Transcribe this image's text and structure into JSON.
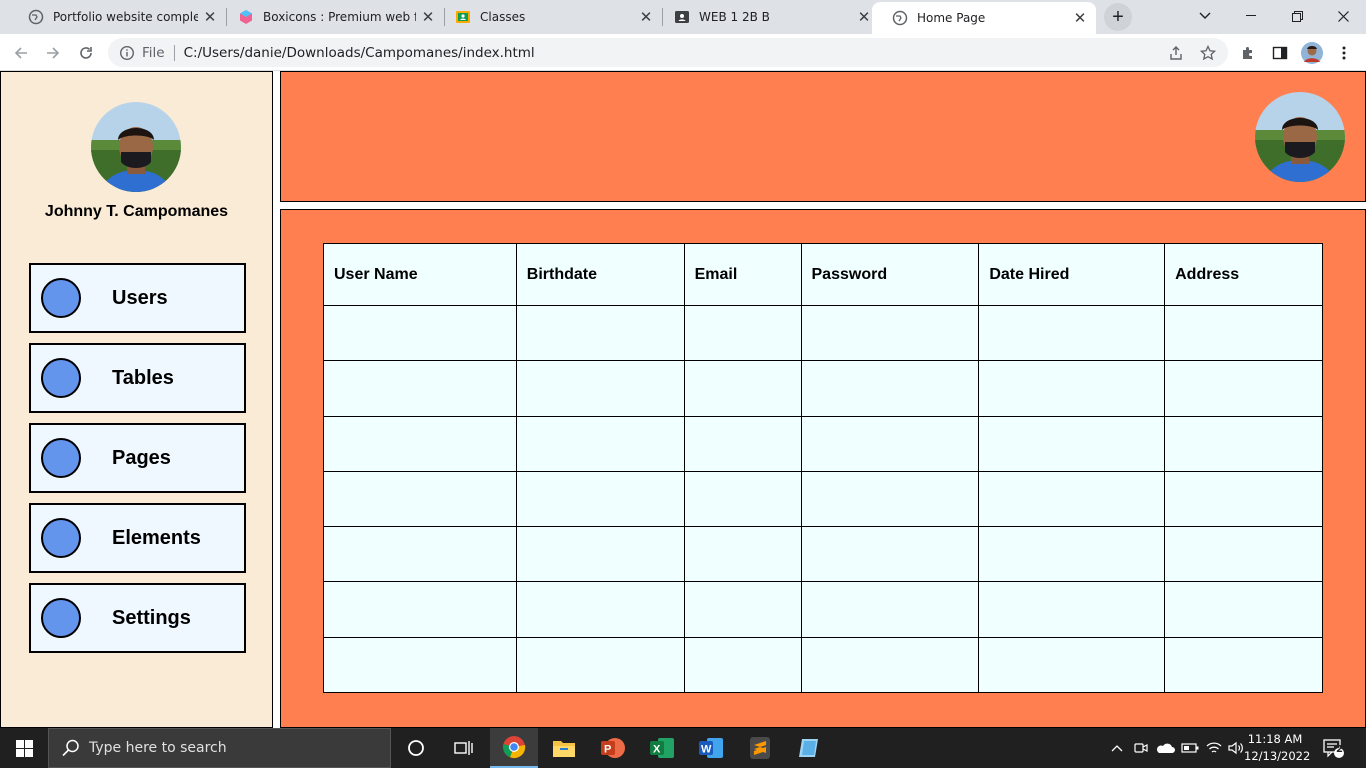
{
  "browser": {
    "tabs": [
      {
        "title": "Portfolio website complete",
        "icon": "globe-icon",
        "active": false
      },
      {
        "title": "Boxicons : Premium web frien",
        "icon": "boxicons-cube-icon",
        "active": false
      },
      {
        "title": "Classes",
        "icon": "google-classroom-icon",
        "active": false
      },
      {
        "title": "WEB 1 2B B",
        "icon": "contact-card-icon",
        "active": false
      },
      {
        "title": "Home Page",
        "icon": "globe-icon",
        "active": true
      }
    ],
    "close_glyph": "✕",
    "new_tab_glyph": "+",
    "address": {
      "scheme_label": "File",
      "url": "C:/Users/danie/Downloads/Campomanes/index.html"
    }
  },
  "sidebar": {
    "user_name": "Johnny T. Campomanes",
    "nav_items": [
      {
        "label": "Users"
      },
      {
        "label": "Tables"
      },
      {
        "label": "Pages"
      },
      {
        "label": "Elements"
      },
      {
        "label": "Settings"
      }
    ]
  },
  "table": {
    "headers": [
      "User Name",
      "Birthdate",
      "Email",
      "Password",
      "Date Hired",
      "Address"
    ],
    "rows": [
      [
        "",
        "",
        "",
        "",
        "",
        ""
      ],
      [
        "",
        "",
        "",
        "",
        "",
        ""
      ],
      [
        "",
        "",
        "",
        "",
        "",
        ""
      ],
      [
        "",
        "",
        "",
        "",
        "",
        ""
      ],
      [
        "",
        "",
        "",
        "",
        "",
        ""
      ],
      [
        "",
        "",
        "",
        "",
        "",
        ""
      ],
      [
        "",
        "",
        "",
        "",
        "",
        ""
      ]
    ]
  },
  "taskbar": {
    "search_placeholder": "Type here to search",
    "apps": [
      "cortana-circle-icon",
      "task-view-icon",
      "chrome-icon",
      "file-explorer-icon",
      "powerpoint-icon",
      "excel-icon",
      "word-icon",
      "sublime-text-icon",
      "app-icon"
    ],
    "time": "11:18 AM",
    "date": "12/13/2022",
    "notification_count": "2"
  },
  "colors": {
    "sidebar_bg": "#faebd7",
    "accent_coral": "#ff7f50",
    "nav_item_bg": "#f0f8ff",
    "nav_circle": "#6495ed",
    "table_bg": "#f0ffff"
  }
}
